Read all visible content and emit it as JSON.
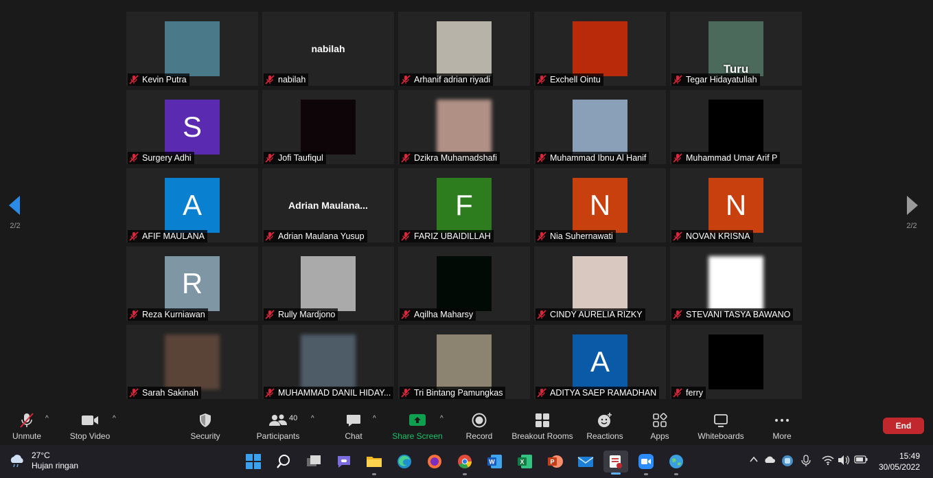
{
  "participants": [
    {
      "name": "Kevin Putra",
      "avatar": "anime-portrait-image",
      "bg": "#4a7a8a"
    },
    {
      "name": "nabilah",
      "center_name": "nabilah"
    },
    {
      "name": "Arhanif adrian riyadi",
      "avatar": "silhouette-image",
      "bg": "#b8b3a8"
    },
    {
      "name": "Exchell Ointu",
      "avatar": "fire-flower-image",
      "bg": "#b82a0a"
    },
    {
      "name": "Tegar Hidayatullah",
      "avatar": "cat-meme-image",
      "bg": "#4c6a5c",
      "caption": "Turu"
    },
    {
      "name": "Surgery Adhi",
      "letter": "S",
      "bg": "#5a2bb0"
    },
    {
      "name": "Jofi Taufiqul",
      "avatar": "dark-image",
      "bg": "#0e0509"
    },
    {
      "name": "Dzikra Muhamadshafi",
      "avatar": "blurred-photo",
      "bg": "#b09085",
      "blur": true
    },
    {
      "name": "Muhammad Ibnu Al Hanif",
      "avatar": "pilot-photo",
      "bg": "#8aa0b8"
    },
    {
      "name": "Muhammad Umar Arif P",
      "avatar": "logo-image",
      "bg": "#000000"
    },
    {
      "name": "AFIF MAULANA",
      "letter": "A",
      "bg": "#0a80d0"
    },
    {
      "name": "Adrian Maulana Yusup",
      "center_name": "Adrian  Maulana..."
    },
    {
      "name": "FARIZ UBAIDILLAH",
      "letter": "F",
      "bg": "#2d7d1f"
    },
    {
      "name": "Nia Suhernawati",
      "letter": "N",
      "bg": "#c8400e"
    },
    {
      "name": "NOVAN KRISNA",
      "letter": "N",
      "bg": "#c8400e"
    },
    {
      "name": "Reza Kurniawan",
      "letter": "R",
      "bg": "#7f96a5"
    },
    {
      "name": "Rully Mardjono",
      "avatar": "man-portrait-photo",
      "bg": "#aaaaaa"
    },
    {
      "name": "Aqilha Maharsy",
      "avatar": "dark-image",
      "bg": "#020a05"
    },
    {
      "name": "CINDY AURELIA RIZKY",
      "avatar": "cat-photo",
      "bg": "#d9c8c0"
    },
    {
      "name": "STEVANI TASYA BAWANO",
      "avatar": "white-image",
      "bg": "#ffffff",
      "blur": true
    },
    {
      "name": "Sarah Sakinah",
      "avatar": "blurred-photo",
      "bg": "#5a4438",
      "blur": true
    },
    {
      "name": "MUHAMMAD DANIL HIDAY...",
      "avatar": "blurred-photo",
      "bg": "#4e5c68",
      "blur": true
    },
    {
      "name": "Tri Bintang Pamungkas",
      "avatar": "street-photo",
      "bg": "#8c8470"
    },
    {
      "name": "ADITYA SAEP RAMADHAN",
      "letter": "A",
      "bg": "#0a5aa8"
    },
    {
      "name": "ferry",
      "avatar": "black-image",
      "bg": "#000000"
    }
  ],
  "pager": {
    "left": "2/2",
    "right": "2/2"
  },
  "toolbar": {
    "unmute": "Unmute",
    "stop_video": "Stop Video",
    "security": "Security",
    "participants": "Participants",
    "participants_count": "40",
    "chat": "Chat",
    "share_screen": "Share Screen",
    "record": "Record",
    "breakout_rooms": "Breakout Rooms",
    "reactions": "Reactions",
    "apps": "Apps",
    "whiteboards": "Whiteboards",
    "more": "More",
    "end": "End",
    "caret": "^"
  },
  "taskbar": {
    "temp": "27°C",
    "weather": "Hujan ringan",
    "time": "15:49",
    "date": "30/05/2022"
  },
  "colors": {
    "share_green": "#0e9f4f",
    "end_red": "#c0282d",
    "mic_red": "#e0243a"
  }
}
